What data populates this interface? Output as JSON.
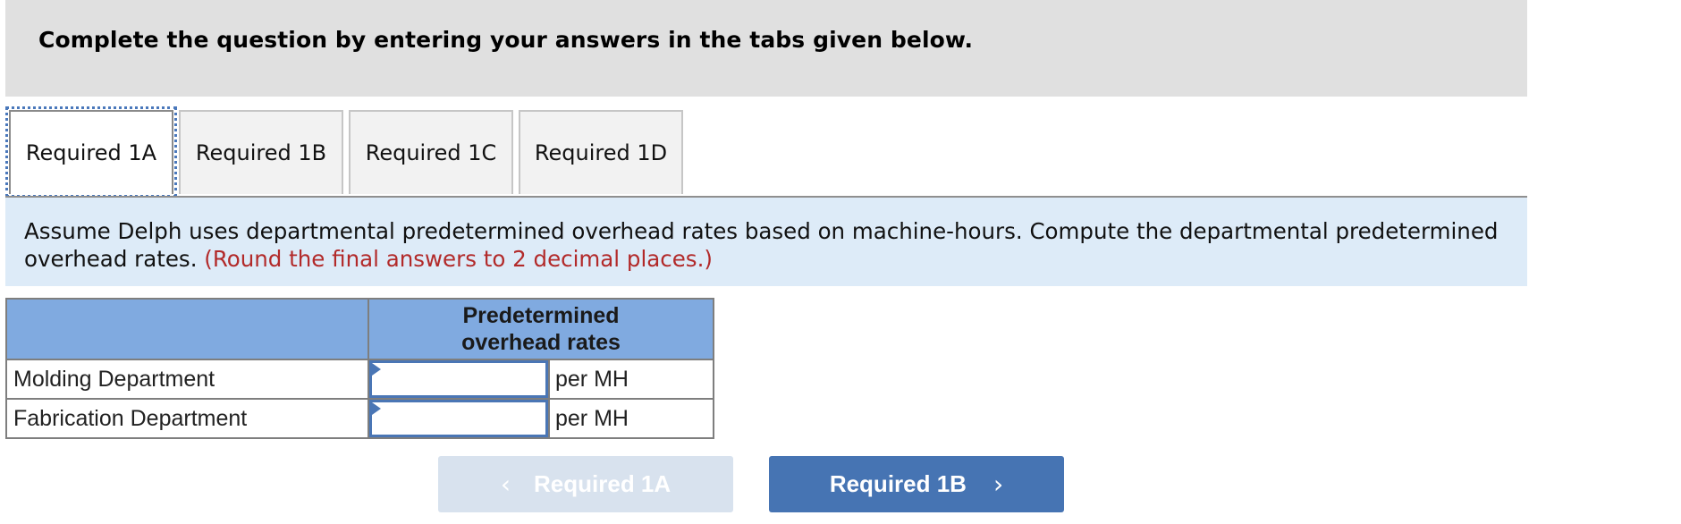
{
  "header": {
    "instruction": "Complete the question by entering your answers in the tabs given below."
  },
  "tabs": [
    {
      "label": "Required 1A",
      "active": true
    },
    {
      "label": "Required 1B",
      "active": false
    },
    {
      "label": "Required 1C",
      "active": false
    },
    {
      "label": "Required 1D",
      "active": false
    }
  ],
  "prompt": {
    "text": "Assume Delph uses departmental predetermined overhead rates based on machine-hours. Compute the departmental predetermined overhead rates.",
    "note": "(Round the final answers to 2 decimal places.)"
  },
  "table": {
    "header_blank": "",
    "column_header": "Predetermined overhead rates",
    "rows": [
      {
        "label": "Molding Department",
        "value": "",
        "unit": "per MH"
      },
      {
        "label": "Fabrication Department",
        "value": "",
        "unit": "per MH"
      }
    ]
  },
  "navigation": {
    "prev": {
      "label": "Required 1A",
      "icon": "chevron-left-icon",
      "glyph": "‹",
      "enabled": false
    },
    "next": {
      "label": "Required 1B",
      "icon": "chevron-right-icon",
      "glyph": "›",
      "enabled": true
    }
  },
  "colors": {
    "accent": "#4674b3",
    "table_header": "#80aae0",
    "prompt_background": "#ddebf8",
    "note_red": "#b22a2a",
    "header_background": "#e0e0e0"
  }
}
